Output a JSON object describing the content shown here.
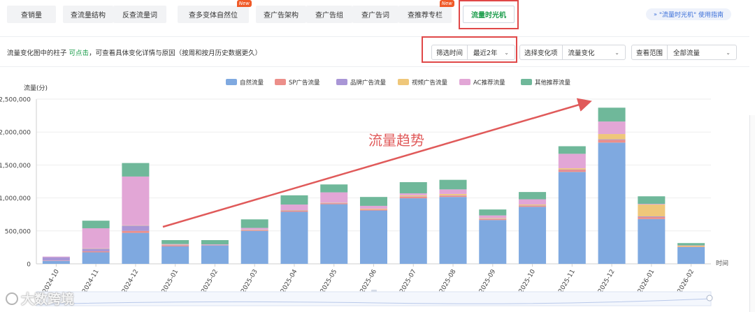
{
  "tabs": [
    {
      "label": "查销量"
    },
    {
      "label": "查流量结构"
    },
    {
      "label": "反查流量词"
    },
    {
      "label": "查多变体自然位",
      "badge": "New"
    },
    {
      "label": "查广告架构"
    },
    {
      "label": "查广告组"
    },
    {
      "label": "查广告词"
    },
    {
      "label": "查推荐专栏",
      "badge": "New"
    },
    {
      "label": "流量时光机",
      "active": true
    }
  ],
  "guide_link": "\"流量时光机\" 使用指南",
  "filter": {
    "hint_prefix": "流量变化图中的柱子",
    "hint_link": "可点击",
    "hint_suffix": "，可查看具体变化详情与原因（按周和按月历史数据更久）",
    "time_label": "筛选时间",
    "time_value": "最近2年",
    "change_label": "选择变化项",
    "change_value": "流量变化",
    "scope_label": "查看范围",
    "scope_value": "全部流量"
  },
  "watermark": "大数跨境",
  "colors": {
    "accent": "#1a9c4a",
    "highlight_red": "#e04848"
  },
  "chart_data": {
    "type": "bar",
    "stacked": true,
    "ylabel": "流量(分)",
    "xlabel": "时间",
    "ylim": [
      0,
      2500000
    ],
    "yticks": [
      0,
      500000,
      1000000,
      1500000,
      2000000,
      2500000
    ],
    "ytick_labels": [
      "0",
      "500,000",
      "1,000,000",
      "1,500,000",
      "2,000,000",
      "2,500,000"
    ],
    "legend_position": "top-center",
    "grid": true,
    "categories": [
      "2024-10",
      "2024-11",
      "2024-12",
      "2025-01",
      "2025-02",
      "2025-03",
      "2025-04",
      "2025-05",
      "2025-06",
      "2025-07",
      "2025-08",
      "2025-09",
      "2025-10",
      "2025-11",
      "2025-12",
      "2026-01",
      "2026-02"
    ],
    "series": [
      {
        "name": "自然流量",
        "color": "#7fa9e0",
        "values": [
          45000,
          175000,
          470000,
          265000,
          280000,
          500000,
          790000,
          905000,
          810000,
          995000,
          1015000,
          665000,
          865000,
          1395000,
          1840000,
          680000,
          255000
        ]
      },
      {
        "name": "SP广告流量",
        "color": "#ec8f8a",
        "values": [
          5000,
          15000,
          30000,
          15000,
          5000,
          10000,
          15000,
          15000,
          15000,
          25000,
          20000,
          15000,
          15000,
          30000,
          40000,
          30000,
          5000
        ]
      },
      {
        "name": "品牌广告流量",
        "color": "#a996d6",
        "values": [
          50000,
          40000,
          80000,
          5000,
          0,
          5000,
          5000,
          5000,
          0,
          5000,
          5000,
          5000,
          5000,
          5000,
          10000,
          10000,
          0
        ]
      },
      {
        "name": "视频广告流量",
        "color": "#efc77a",
        "values": [
          0,
          5000,
          5000,
          5000,
          0,
          5000,
          5000,
          5000,
          10000,
          15000,
          20000,
          10000,
          15000,
          20000,
          80000,
          180000,
          15000
        ]
      },
      {
        "name": "AC推荐流量",
        "color": "#e2a6d6",
        "values": [
          10000,
          305000,
          740000,
          10000,
          10000,
          25000,
          85000,
          155000,
          45000,
          30000,
          70000,
          40000,
          80000,
          220000,
          190000,
          10000,
          5000
        ]
      },
      {
        "name": "其他推荐流量",
        "color": "#6fb89a",
        "values": [
          0,
          115000,
          205000,
          60000,
          65000,
          130000,
          140000,
          120000,
          135000,
          170000,
          145000,
          90000,
          110000,
          115000,
          210000,
          115000,
          35000
        ]
      }
    ],
    "annotation": {
      "text": "流量趋势",
      "color": "#e05a5a"
    }
  }
}
